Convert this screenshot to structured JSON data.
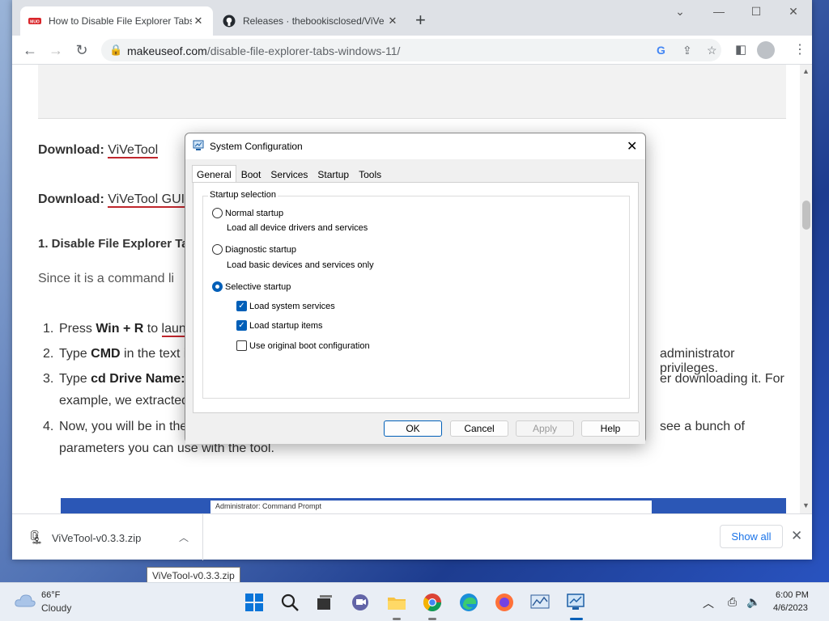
{
  "browser": {
    "tabs": [
      {
        "title": "How to Disable File Explorer Tabs",
        "favicon": "makeuseof-icon",
        "active": true
      },
      {
        "title": "Releases · thebookisclosed/ViVe",
        "favicon": "github-icon",
        "active": false
      }
    ],
    "url_domain": "makeuseof.com",
    "url_path": "/disable-file-explorer-tabs-windows-11/"
  },
  "article": {
    "download1_label": "Download:",
    "download1_link": "ViVeTool",
    "download2_label": "Download:",
    "download2_link": "ViVeTool GUI",
    "heading": "1. Disable File Explorer Ta",
    "para": "Since it is a command li",
    "steps": [
      {
        "num": "1.",
        "a": "Press ",
        "b": "Win + R",
        "c": " to ",
        "link": "launc",
        "d": ""
      },
      {
        "num": "2.",
        "a": "Type ",
        "b": "CMD",
        "c": " in the text i",
        "link": "",
        "d": "administrator privileges."
      },
      {
        "num": "3.",
        "a": "Type ",
        "b": "cd Drive Name:\\",
        "c": "",
        "link": "",
        "d": "er downloading it. For"
      },
      {
        "num": "",
        "a": "example, we extracted",
        "b": "",
        "c": "",
        "link": "",
        "d": ""
      },
      {
        "num": "4.",
        "a": "Now, you will be in the",
        "b": "",
        "c": "",
        "link": "",
        "d": "see a bunch of"
      },
      {
        "num": "",
        "a": "parameters you can use with the tool.",
        "b": "",
        "c": "",
        "link": "",
        "d": ""
      }
    ],
    "cmd_title": "Administrator: Command Prompt"
  },
  "downloads": {
    "file": "ViVeTool-v0.3.3.zip",
    "show_all": "Show all",
    "tooltip": "ViVeTool-v0.3.3.zip"
  },
  "dialog": {
    "title": "System Configuration",
    "tabs": [
      "General",
      "Boot",
      "Services",
      "Startup",
      "Tools"
    ],
    "group_label": "Startup selection",
    "normal": "Normal startup",
    "normal_desc": "Load all device drivers and services",
    "diagnostic": "Diagnostic startup",
    "diagnostic_desc": "Load basic devices and services only",
    "selective": "Selective startup",
    "opt_system": "Load system services",
    "opt_startup": "Load startup items",
    "opt_boot": "Use original boot configuration",
    "buttons": {
      "ok": "OK",
      "cancel": "Cancel",
      "apply": "Apply",
      "help": "Help"
    }
  },
  "taskbar": {
    "temp": "66°F",
    "weather": "Cloudy",
    "time": "6:00 PM",
    "date": "4/6/2023"
  }
}
